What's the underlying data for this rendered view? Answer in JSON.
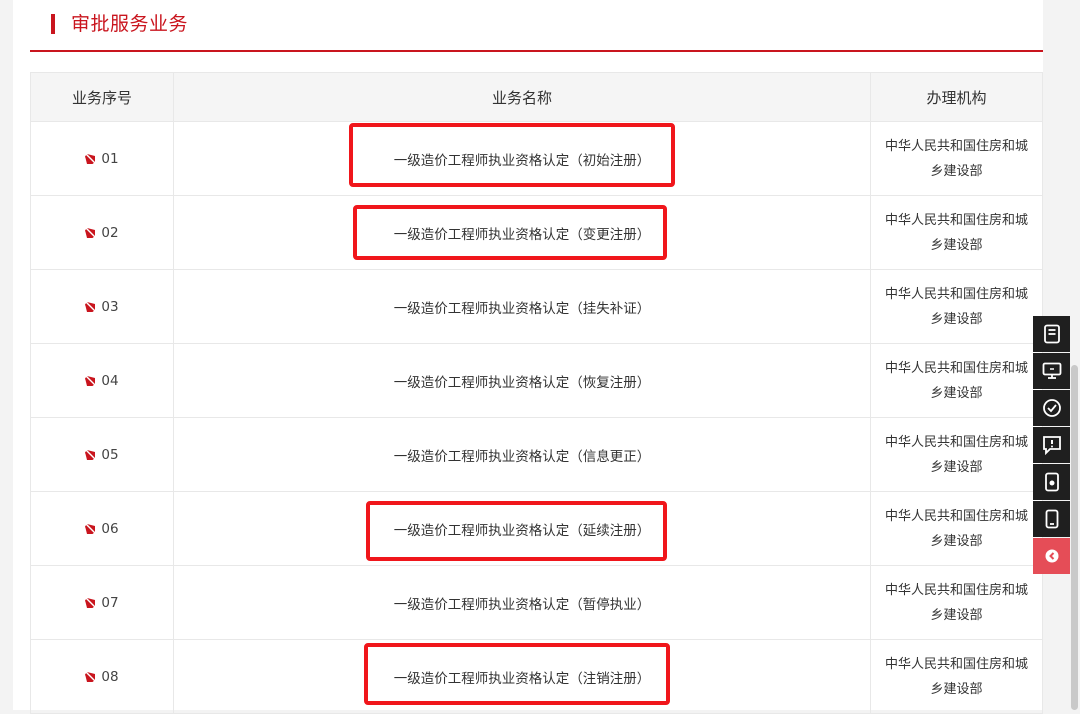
{
  "section": {
    "title": "审批服务业务"
  },
  "table": {
    "headers": [
      "业务序号",
      "业务名称",
      "办理机构"
    ],
    "rows": [
      {
        "seq": "01",
        "name": "一级造价工程师执业资格认定（初始注册）",
        "org_line1": "中华人民共和国住房和城",
        "org_line2": "乡建设部",
        "highlighted": true
      },
      {
        "seq": "02",
        "name": "一级造价工程师执业资格认定（变更注册）",
        "org_line1": "中华人民共和国住房和城",
        "org_line2": "乡建设部",
        "highlighted": true
      },
      {
        "seq": "03",
        "name": "一级造价工程师执业资格认定（挂失补证）",
        "org_line1": "中华人民共和国住房和城",
        "org_line2": "乡建设部",
        "highlighted": false
      },
      {
        "seq": "04",
        "name": "一级造价工程师执业资格认定（恢复注册）",
        "org_line1": "中华人民共和国住房和城",
        "org_line2": "乡建设部",
        "highlighted": false
      },
      {
        "seq": "05",
        "name": "一级造价工程师执业资格认定（信息更正）",
        "org_line1": "中华人民共和国住房和城",
        "org_line2": "乡建设部",
        "highlighted": false
      },
      {
        "seq": "06",
        "name": "一级造价工程师执业资格认定（延续注册）",
        "org_line1": "中华人民共和国住房和城",
        "org_line2": "乡建设部",
        "highlighted": true
      },
      {
        "seq": "07",
        "name": "一级造价工程师执业资格认定（暂停执业）",
        "org_line1": "中华人民共和国住房和城",
        "org_line2": "乡建设部",
        "highlighted": false
      },
      {
        "seq": "08",
        "name": "一级造价工程师执业资格认定（注销注册）",
        "org_line1": "中华人民共和国住房和城",
        "org_line2": "乡建设部",
        "highlighted": true
      }
    ]
  },
  "side_toolbar": {
    "items": [
      "document-icon",
      "monitor-icon",
      "checklist-icon",
      "feedback-icon",
      "mobile-service-icon",
      "phone-icon",
      "back-top-icon"
    ]
  },
  "colors": {
    "accent": "#c9151e",
    "highlight": "#f0161b",
    "toolbar": "#1f1f1f",
    "back_button": "#e54d57"
  }
}
